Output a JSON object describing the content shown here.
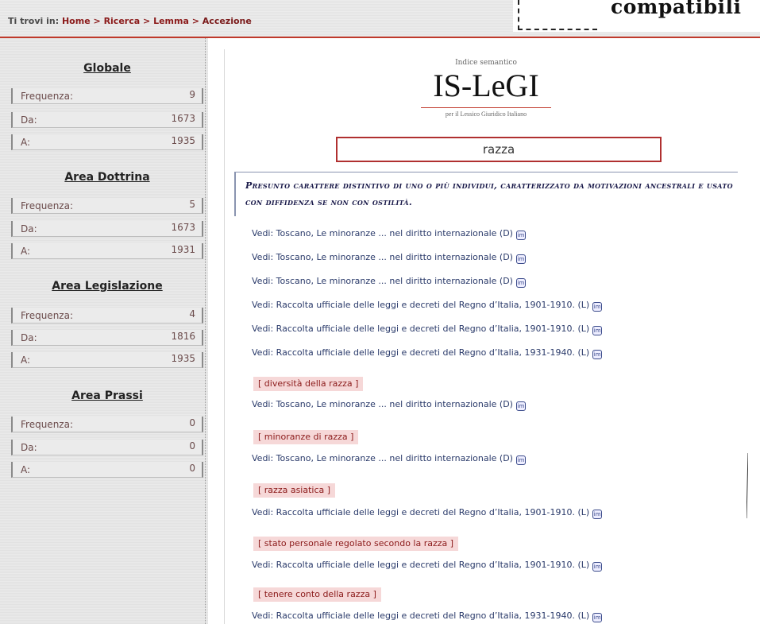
{
  "breadcrumb": {
    "prefix": "Ti trovi in:",
    "items": [
      "Home",
      "Ricerca",
      "Lemma",
      "Accezione"
    ],
    "separator": ">"
  },
  "ad": {
    "text": "compatibili"
  },
  "sidebar": {
    "sections": [
      {
        "title": "Globale",
        "frequenza": "9",
        "da": "1673",
        "a": "1935"
      },
      {
        "title": "Area Dottrina",
        "frequenza": "5",
        "da": "1673",
        "a": "1931"
      },
      {
        "title": "Area Legislazione",
        "frequenza": "4",
        "da": "1816",
        "a": "1935"
      },
      {
        "title": "Area Prassi",
        "frequenza": "0",
        "da": "0",
        "a": "0"
      }
    ],
    "labels": {
      "frequenza": "Frequenza:",
      "da": "Da:",
      "a": "A:"
    }
  },
  "logo": {
    "subtitle": "Indice semantico",
    "title": "IS-LeGI",
    "tagline": "per il Lessico Giuridico Italiano"
  },
  "lemma": "razza",
  "definition": "Presunto carattere distintivo di uno o più individui, caratterizzato da motivazioni ancestrali e usato con diffidenza se non con ostilità.",
  "entries": [
    "Vedi: Toscano, Le minoranze ... nel diritto internazionale (D)",
    "Vedi: Toscano, Le minoranze ... nel diritto internazionale (D)",
    "Vedi: Toscano, Le minoranze ... nel diritto internazionale (D)",
    "Vedi: Raccolta ufficiale delle leggi e decreti del Regno d’Italia, 1901-1910. (L)",
    "Vedi: Raccolta ufficiale delle leggi e decreti del Regno d’Italia, 1901-1910. (L)",
    "Vedi: Raccolta ufficiale delle leggi e decreti del Regno d’Italia, 1931-1940. (L)"
  ],
  "groups": [
    {
      "tag": "[ diversità della razza ]",
      "entry": "Vedi: Toscano, Le minoranze ... nel diritto internazionale (D)"
    },
    {
      "tag": "[ minoranze di razza ]",
      "entry": "Vedi: Toscano, Le minoranze ... nel diritto internazionale (D)"
    },
    {
      "tag": "[ razza asiatica ]",
      "entry": "Vedi: Raccolta ufficiale delle leggi e decreti del Regno d’Italia, 1901-1910. (L)"
    },
    {
      "tag": "[ stato personale regolato secondo la razza ]",
      "entry": "Vedi: Raccolta ufficiale delle leggi e decreti del Regno d’Italia, 1901-1910. (L)"
    },
    {
      "tag": "[ tenere conto della razza ]",
      "entry": "Vedi: Raccolta ufficiale delle leggi e decreti del Regno d’Italia, 1931-1940. (L)"
    }
  ],
  "im_icon_label": "im",
  "colors": {
    "accent": "#c0392b",
    "link": "#2a3a6a",
    "tag_bg": "#f6d8d8"
  }
}
